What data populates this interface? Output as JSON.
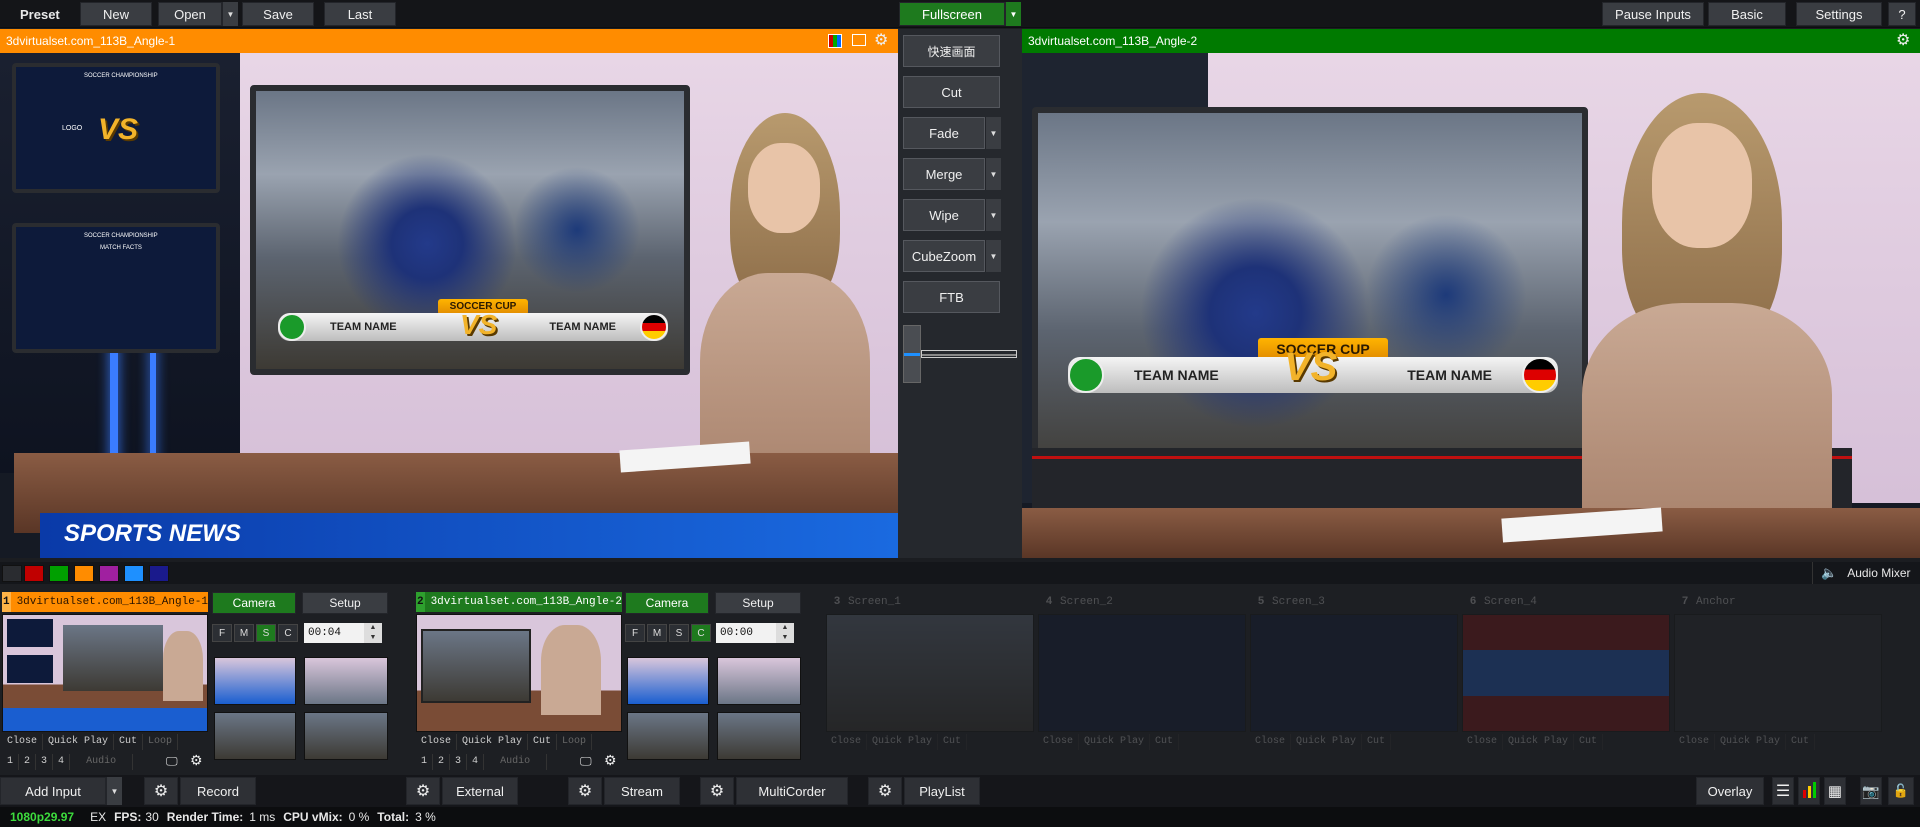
{
  "toolbar": {
    "preset": "Preset",
    "new": "New",
    "open": "Open",
    "save": "Save",
    "last": "Last",
    "fullscreen": "Fullscreen",
    "pause_inputs": "Pause Inputs",
    "basic": "Basic",
    "settings": "Settings",
    "help": "?"
  },
  "preview": {
    "title": "3dvirtualset.com_113B_Angle-1",
    "title_color": "#ff8c00",
    "overlay_text": "SPORTS NEWS",
    "soccer_cup": "SOCCER CUP",
    "vs": "VS",
    "team_left": "TEAM NAME",
    "team_right": "TEAM NAME",
    "small_screen_title_1": "SOCCER CHAMPIONSHIP",
    "small_screen_title_2": "SOCCER CHAMPIONSHIP",
    "logo": "LOGO",
    "match_facts": "MATCH FACTS"
  },
  "output": {
    "title": "3dvirtualset.com_113B_Angle-2",
    "title_color": "#007a00",
    "soccer_cup": "SOCCER CUP",
    "vs": "VS",
    "team_left": "TEAM NAME",
    "team_right": "TEAM NAME"
  },
  "transitions": {
    "quick": "快速画面",
    "cut": "Cut",
    "fade": "Fade",
    "merge": "Merge",
    "wipe": "Wipe",
    "cubezoom": "CubeZoom",
    "ftb": "FTB"
  },
  "color_swatches": [
    "#2a2c30",
    "#c00000",
    "#00a000",
    "#ff8c00",
    "#a020a0",
    "#1e90ff",
    "#1a1a8c"
  ],
  "audio_mixer": "Audio Mixer",
  "inputs": [
    {
      "number": "1",
      "title": "3dvirtualset.com_113B_Angle-1",
      "header_color": "#ff8c00",
      "camera": "Camera",
      "setup": "Setup",
      "time": "00:04",
      "active_letter": "S"
    },
    {
      "number": "2",
      "title": "3dvirtualset.com_113B_Angle-2",
      "header_color": "#1e7a1e",
      "camera": "Camera",
      "setup": "Setup",
      "time": "00:00",
      "active_letter": "C"
    }
  ],
  "input_letters": [
    "F",
    "M",
    "S",
    "C"
  ],
  "input_controls": [
    "Close",
    "Quick Play",
    "Cut",
    "Loop"
  ],
  "input_numbers": [
    "1",
    "2",
    "3",
    "4"
  ],
  "audio_label": "Audio",
  "dim_inputs": [
    {
      "number": "3",
      "title": "Screen_1"
    },
    {
      "number": "4",
      "title": "Screen_2"
    },
    {
      "number": "5",
      "title": "Screen_3"
    },
    {
      "number": "6",
      "title": "Screen_4"
    },
    {
      "number": "7",
      "title": "Anchor"
    }
  ],
  "dim_controls": [
    "Close",
    "Quick Play",
    "Cut"
  ],
  "bottom": {
    "add_input": "Add Input",
    "record": "Record",
    "external": "External",
    "stream": "Stream",
    "multicorder": "MultiCorder",
    "playlist": "PlayList",
    "overlay": "Overlay"
  },
  "status": {
    "format": "1080p29.97",
    "ex": "EX",
    "fps_label": "FPS:",
    "fps": "30",
    "render_label": "Render Time:",
    "render": "1 ms",
    "cpu_label": "CPU vMix:",
    "cpu": "0 %",
    "total_label": "Total:",
    "total": "3 %"
  }
}
